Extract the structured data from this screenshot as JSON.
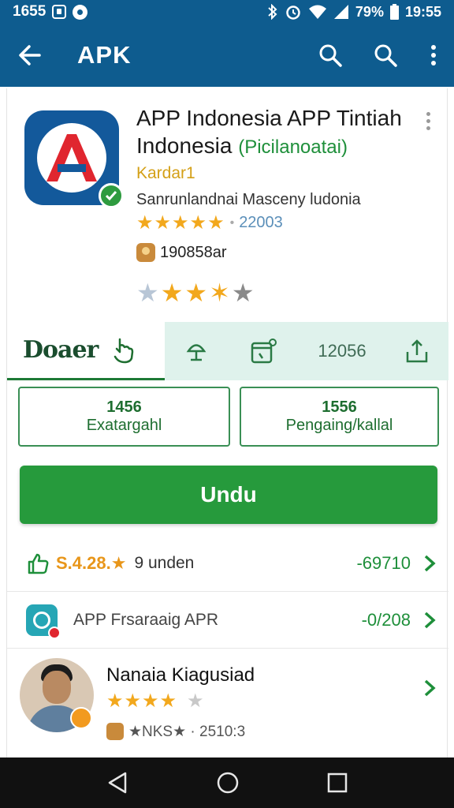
{
  "status_bar": {
    "time_left": "1655",
    "battery": "79%",
    "time_right": "19:55"
  },
  "app_bar": {
    "title": "APK",
    "icons": [
      "back-arrow-icon",
      "search-icon",
      "search-icon",
      "more-vert-icon"
    ]
  },
  "app": {
    "title_line1": "APP Indonesia APP Tintiah",
    "title_line2": "Indonesia",
    "title_sub": "(Picilanoatai)",
    "developer": "Kardar1",
    "tagline": "Sanrunlandnai Masceny ludonia",
    "stars_text": "★★★★★",
    "rating_count": "22003",
    "badge_text": "190858ar",
    "accent_color": "#269a3c",
    "brand_color": "#0e5c8f"
  },
  "tabs": {
    "main_label": "Doaer",
    "count": "12056"
  },
  "stats": [
    {
      "num": "1456",
      "label": "Exatargahl"
    },
    {
      "num": "1556",
      "label": "Pengaing/kallal"
    }
  ],
  "install_label": "Undu",
  "rows": {
    "row1": {
      "rating": "S.4.28.★",
      "text": "9 unden",
      "value": "-69710"
    },
    "row2": {
      "text": "APP Frsaraaig APR",
      "value": "-0/208"
    },
    "row3": {
      "name": "Nanaia Kiagusiad",
      "stars_text": "★★★★",
      "meta": "★NKS★ · 2510:3"
    }
  },
  "nav": {
    "icons": [
      "back-triangle-icon",
      "home-circle-icon",
      "recents-square-icon"
    ]
  }
}
